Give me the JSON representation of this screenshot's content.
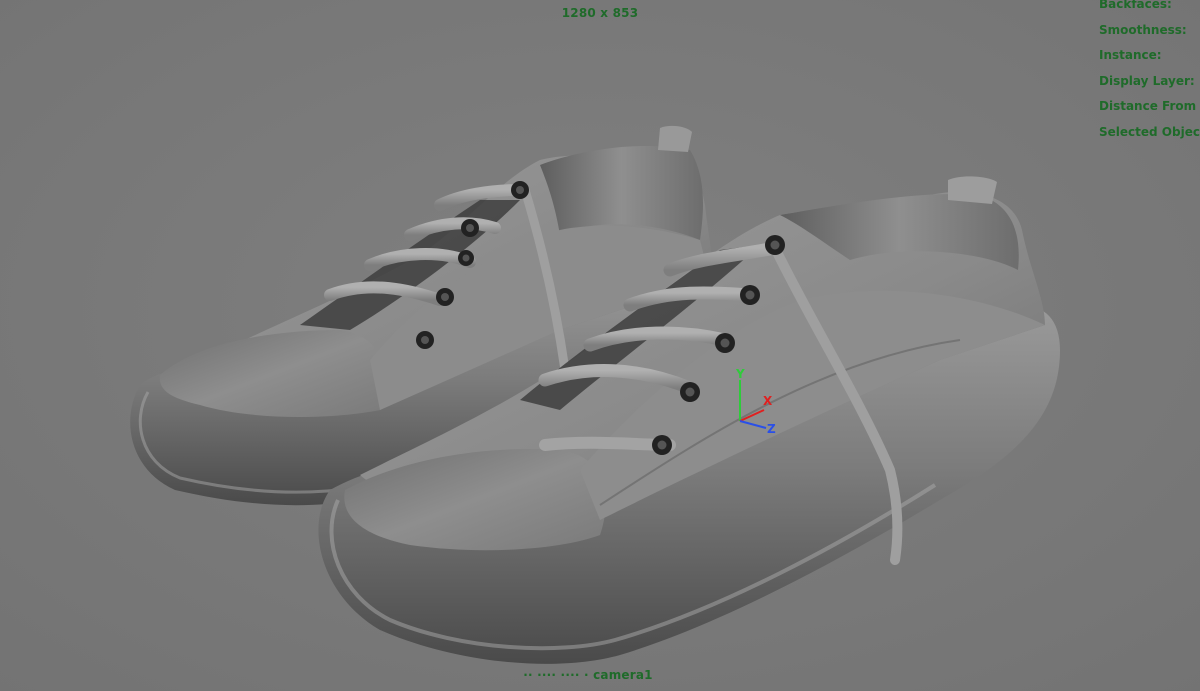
{
  "viewport": {
    "resolution_gate": "1280 x 853",
    "camera_label": "·· ···· ···· · camera1",
    "heads_up_display": [
      "Backfaces:",
      "Smoothness:",
      "Instance:",
      "Display Layer:",
      "Distance From C",
      "Selected Objects"
    ]
  },
  "scene": {
    "object": "pair-of-sneakers-3d-model",
    "shading": "smooth-shaded-grey",
    "background_color": "#7b7b7b"
  },
  "manipulator": {
    "axes": [
      "Y",
      "X",
      "Z"
    ],
    "colors": {
      "Y": "#2ecc3a",
      "X": "#e02020",
      "Z": "#2a50e8"
    }
  }
}
